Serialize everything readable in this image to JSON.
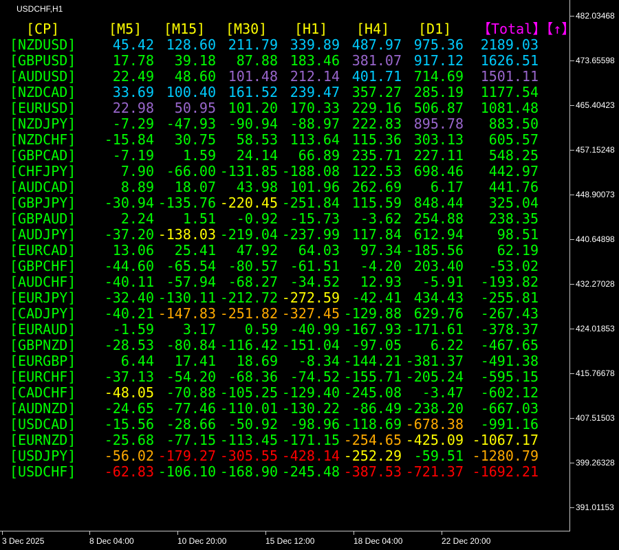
{
  "title": "USDCHF,H1",
  "headers": {
    "cp": "[CP]",
    "periods": [
      "[M5]",
      "[M15]",
      "[M30]",
      "[H1]",
      "[H4]",
      "[D1]"
    ],
    "total": "【Total】【↑】"
  },
  "colors": {
    "header": "#ffff00",
    "total_header": "#ff00ff",
    "symbol": "#00ff00",
    "green": "#00ff00",
    "cyan": "#00ccff",
    "purple": "#9966cc",
    "yellow": "#ffff00",
    "orange": "#ffaa00",
    "red": "#ff0000",
    "axis_text": "#ffffff",
    "axis_line": "#c8c8c8"
  },
  "rows": [
    {
      "symbol": "[NZDUSD]",
      "values": [
        [
          "45.42",
          "cyan"
        ],
        [
          "128.60",
          "cyan"
        ],
        [
          "211.79",
          "cyan"
        ],
        [
          "339.89",
          "cyan"
        ],
        [
          "487.97",
          "cyan"
        ],
        [
          "975.36",
          "cyan"
        ],
        [
          "2189.03",
          "cyan"
        ]
      ]
    },
    {
      "symbol": "[GBPUSD]",
      "values": [
        [
          "17.78",
          "green"
        ],
        [
          "39.18",
          "green"
        ],
        [
          "87.88",
          "green"
        ],
        [
          "183.46",
          "green"
        ],
        [
          "381.07",
          "purple"
        ],
        [
          "917.12",
          "cyan"
        ],
        [
          "1626.51",
          "cyan"
        ]
      ]
    },
    {
      "symbol": "[AUDUSD]",
      "values": [
        [
          "22.49",
          "green"
        ],
        [
          "48.60",
          "green"
        ],
        [
          "101.48",
          "purple"
        ],
        [
          "212.14",
          "purple"
        ],
        [
          "401.71",
          "cyan"
        ],
        [
          "714.69",
          "green"
        ],
        [
          "1501.11",
          "purple"
        ]
      ]
    },
    {
      "symbol": "[NZDCAD]",
      "values": [
        [
          "33.69",
          "cyan"
        ],
        [
          "100.40",
          "cyan"
        ],
        [
          "161.52",
          "cyan"
        ],
        [
          "239.47",
          "cyan"
        ],
        [
          "357.27",
          "green"
        ],
        [
          "285.19",
          "green"
        ],
        [
          "1177.54",
          "green"
        ]
      ]
    },
    {
      "symbol": "[EURUSD]",
      "values": [
        [
          "22.98",
          "purple"
        ],
        [
          "50.95",
          "purple"
        ],
        [
          "101.20",
          "green"
        ],
        [
          "170.33",
          "green"
        ],
        [
          "229.16",
          "green"
        ],
        [
          "506.87",
          "green"
        ],
        [
          "1081.48",
          "green"
        ]
      ]
    },
    {
      "symbol": "[NZDJPY]",
      "values": [
        [
          "-7.29",
          "green"
        ],
        [
          "-47.93",
          "green"
        ],
        [
          "-90.94",
          "green"
        ],
        [
          "-88.97",
          "green"
        ],
        [
          "222.83",
          "green"
        ],
        [
          "895.78",
          "purple"
        ],
        [
          "883.50",
          "green"
        ]
      ]
    },
    {
      "symbol": "[NZDCHF]",
      "values": [
        [
          "-15.84",
          "green"
        ],
        [
          "30.75",
          "green"
        ],
        [
          "58.53",
          "green"
        ],
        [
          "113.64",
          "green"
        ],
        [
          "115.36",
          "green"
        ],
        [
          "303.13",
          "green"
        ],
        [
          "605.57",
          "green"
        ]
      ]
    },
    {
      "symbol": "[GBPCAD]",
      "values": [
        [
          "-7.19",
          "green"
        ],
        [
          "1.59",
          "green"
        ],
        [
          "24.14",
          "green"
        ],
        [
          "66.89",
          "green"
        ],
        [
          "235.71",
          "green"
        ],
        [
          "227.11",
          "green"
        ],
        [
          "548.25",
          "green"
        ]
      ]
    },
    {
      "symbol": "[CHFJPY]",
      "values": [
        [
          "7.90",
          "green"
        ],
        [
          "-66.00",
          "green"
        ],
        [
          "-131.85",
          "green"
        ],
        [
          "-188.08",
          "green"
        ],
        [
          "122.53",
          "green"
        ],
        [
          "698.46",
          "green"
        ],
        [
          "442.97",
          "green"
        ]
      ]
    },
    {
      "symbol": "[AUDCAD]",
      "values": [
        [
          "8.89",
          "green"
        ],
        [
          "18.07",
          "green"
        ],
        [
          "43.98",
          "green"
        ],
        [
          "101.96",
          "green"
        ],
        [
          "262.69",
          "green"
        ],
        [
          "6.17",
          "green"
        ],
        [
          "441.76",
          "green"
        ]
      ]
    },
    {
      "symbol": "[GBPJPY]",
      "values": [
        [
          "-30.94",
          "green"
        ],
        [
          "-135.76",
          "green"
        ],
        [
          "-220.45",
          "yellow"
        ],
        [
          "-251.84",
          "green"
        ],
        [
          "115.59",
          "green"
        ],
        [
          "848.44",
          "green"
        ],
        [
          "325.04",
          "green"
        ]
      ]
    },
    {
      "symbol": "[GBPAUD]",
      "values": [
        [
          "2.24",
          "green"
        ],
        [
          "1.51",
          "green"
        ],
        [
          "-0.92",
          "green"
        ],
        [
          "-15.73",
          "green"
        ],
        [
          "-3.62",
          "green"
        ],
        [
          "254.88",
          "green"
        ],
        [
          "238.35",
          "green"
        ]
      ]
    },
    {
      "symbol": "[AUDJPY]",
      "values": [
        [
          "-37.20",
          "green"
        ],
        [
          "-138.03",
          "yellow"
        ],
        [
          "-219.04",
          "green"
        ],
        [
          "-237.99",
          "green"
        ],
        [
          "117.84",
          "green"
        ],
        [
          "612.94",
          "green"
        ],
        [
          "98.51",
          "green"
        ]
      ]
    },
    {
      "symbol": "[EURCAD]",
      "values": [
        [
          "13.06",
          "green"
        ],
        [
          "25.41",
          "green"
        ],
        [
          "47.92",
          "green"
        ],
        [
          "64.03",
          "green"
        ],
        [
          "97.34",
          "green"
        ],
        [
          "-185.56",
          "green"
        ],
        [
          "62.19",
          "green"
        ]
      ]
    },
    {
      "symbol": "[GBPCHF]",
      "values": [
        [
          "-44.60",
          "green"
        ],
        [
          "-65.54",
          "green"
        ],
        [
          "-80.57",
          "green"
        ],
        [
          "-61.51",
          "green"
        ],
        [
          "-4.20",
          "green"
        ],
        [
          "203.40",
          "green"
        ],
        [
          "-53.02",
          "green"
        ]
      ]
    },
    {
      "symbol": "[AUDCHF]",
      "values": [
        [
          "-40.11",
          "green"
        ],
        [
          "-57.94",
          "green"
        ],
        [
          "-68.27",
          "green"
        ],
        [
          "-34.52",
          "green"
        ],
        [
          "12.93",
          "green"
        ],
        [
          "-5.91",
          "green"
        ],
        [
          "-193.82",
          "green"
        ]
      ]
    },
    {
      "symbol": "[EURJPY]",
      "values": [
        [
          "-32.40",
          "green"
        ],
        [
          "-130.11",
          "green"
        ],
        [
          "-212.72",
          "green"
        ],
        [
          "-272.59",
          "yellow"
        ],
        [
          "-42.41",
          "green"
        ],
        [
          "434.43",
          "green"
        ],
        [
          "-255.81",
          "green"
        ]
      ]
    },
    {
      "symbol": "[CADJPY]",
      "values": [
        [
          "-40.21",
          "green"
        ],
        [
          "-147.83",
          "orange"
        ],
        [
          "-251.82",
          "orange"
        ],
        [
          "-327.45",
          "orange"
        ],
        [
          "-129.88",
          "green"
        ],
        [
          "629.76",
          "green"
        ],
        [
          "-267.43",
          "green"
        ]
      ]
    },
    {
      "symbol": "[EURAUD]",
      "values": [
        [
          "-1.59",
          "green"
        ],
        [
          "3.17",
          "green"
        ],
        [
          "0.59",
          "green"
        ],
        [
          "-40.99",
          "green"
        ],
        [
          "-167.93",
          "green"
        ],
        [
          "-171.61",
          "green"
        ],
        [
          "-378.37",
          "green"
        ]
      ]
    },
    {
      "symbol": "[GBPNZD]",
      "values": [
        [
          "-28.53",
          "green"
        ],
        [
          "-80.84",
          "green"
        ],
        [
          "-116.42",
          "green"
        ],
        [
          "-151.04",
          "green"
        ],
        [
          "-97.05",
          "green"
        ],
        [
          "6.22",
          "green"
        ],
        [
          "-467.65",
          "green"
        ]
      ]
    },
    {
      "symbol": "[EURGBP]",
      "values": [
        [
          "6.44",
          "green"
        ],
        [
          "17.41",
          "green"
        ],
        [
          "18.69",
          "green"
        ],
        [
          "-8.34",
          "green"
        ],
        [
          "-144.21",
          "green"
        ],
        [
          "-381.37",
          "green"
        ],
        [
          "-491.38",
          "green"
        ]
      ]
    },
    {
      "symbol": "[EURCHF]",
      "values": [
        [
          "-37.13",
          "green"
        ],
        [
          "-54.20",
          "green"
        ],
        [
          "-68.36",
          "green"
        ],
        [
          "-74.52",
          "green"
        ],
        [
          "-155.71",
          "green"
        ],
        [
          "-205.24",
          "green"
        ],
        [
          "-595.15",
          "green"
        ]
      ]
    },
    {
      "symbol": "[CADCHF]",
      "values": [
        [
          "-48.05",
          "yellow"
        ],
        [
          "-70.88",
          "green"
        ],
        [
          "-105.25",
          "green"
        ],
        [
          "-129.40",
          "green"
        ],
        [
          "-245.08",
          "green"
        ],
        [
          "-3.47",
          "green"
        ],
        [
          "-602.12",
          "green"
        ]
      ]
    },
    {
      "symbol": "[AUDNZD]",
      "values": [
        [
          "-24.65",
          "green"
        ],
        [
          "-77.46",
          "green"
        ],
        [
          "-110.01",
          "green"
        ],
        [
          "-130.22",
          "green"
        ],
        [
          "-86.49",
          "green"
        ],
        [
          "-238.20",
          "green"
        ],
        [
          "-667.03",
          "green"
        ]
      ]
    },
    {
      "symbol": "[USDCAD]",
      "values": [
        [
          "-15.56",
          "green"
        ],
        [
          "-28.66",
          "green"
        ],
        [
          "-50.92",
          "green"
        ],
        [
          "-98.96",
          "green"
        ],
        [
          "-118.69",
          "green"
        ],
        [
          "-678.38",
          "orange"
        ],
        [
          "-991.16",
          "green"
        ]
      ]
    },
    {
      "symbol": "[EURNZD]",
      "values": [
        [
          "-25.68",
          "green"
        ],
        [
          "-77.15",
          "green"
        ],
        [
          "-113.45",
          "green"
        ],
        [
          "-171.15",
          "green"
        ],
        [
          "-254.65",
          "orange"
        ],
        [
          "-425.09",
          "yellow"
        ],
        [
          "-1067.17",
          "yellow"
        ]
      ]
    },
    {
      "symbol": "[USDJPY]",
      "values": [
        [
          "-56.02",
          "orange"
        ],
        [
          "-179.27",
          "red"
        ],
        [
          "-305.55",
          "red"
        ],
        [
          "-428.14",
          "red"
        ],
        [
          "-252.29",
          "yellow"
        ],
        [
          "-59.51",
          "green"
        ],
        [
          "-1280.79",
          "orange"
        ]
      ]
    },
    {
      "symbol": "[USDCHF]",
      "values": [
        [
          "-62.83",
          "red"
        ],
        [
          "-106.10",
          "green"
        ],
        [
          "-168.90",
          "green"
        ],
        [
          "-245.48",
          "green"
        ],
        [
          "-387.53",
          "red"
        ],
        [
          "-721.37",
          "red"
        ],
        [
          "-1692.21",
          "red"
        ]
      ]
    }
  ],
  "price_axis": [
    "482.03468",
    "473.65598",
    "465.40423",
    "457.15248",
    "448.90073",
    "440.64898",
    "432.27028",
    "424.01853",
    "415.76678",
    "407.51503",
    "399.26328",
    "391.01153"
  ],
  "time_axis": [
    "3 Dec 2025",
    "8 Dec 04:00",
    "10 Dec 20:00",
    "15 Dec 12:00",
    "18 Dec 04:00",
    "22 Dec 20:00"
  ]
}
